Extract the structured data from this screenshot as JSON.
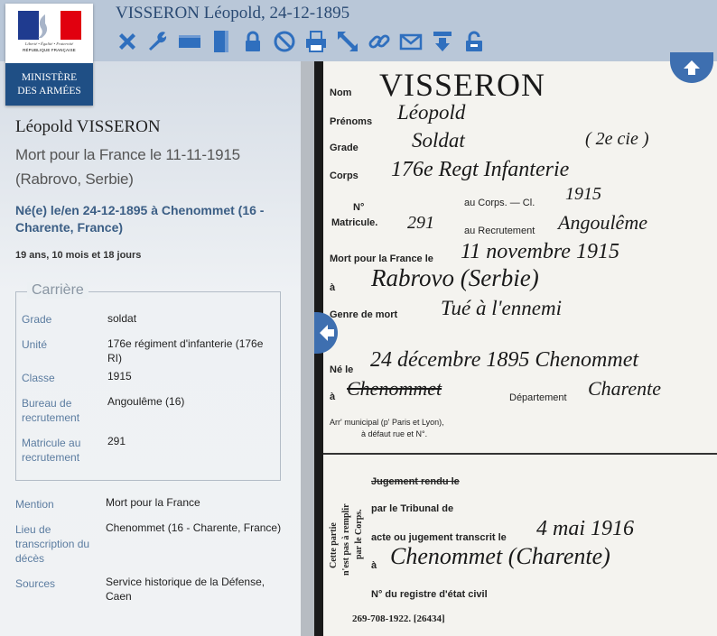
{
  "header": {
    "title": "VISSERON Léopold, 24-12-1895",
    "logo": {
      "motto": "Liberté • Égalité • Fraternité",
      "republic": "RÉPUBLIQUE FRANÇAISE",
      "ministry_line1": "MINISTÈRE",
      "ministry_line2": "DES ARMÉES"
    },
    "toolbar": [
      {
        "name": "close-icon"
      },
      {
        "name": "wrench-icon"
      },
      {
        "name": "horizontal-view-icon"
      },
      {
        "name": "vertical-view-icon"
      },
      {
        "name": "lock-icon"
      },
      {
        "name": "no-entry-icon"
      },
      {
        "name": "print-icon"
      },
      {
        "name": "expand-icon"
      },
      {
        "name": "link-icon"
      },
      {
        "name": "mail-icon"
      },
      {
        "name": "download-icon"
      },
      {
        "name": "unlock-icon"
      }
    ],
    "colors": {
      "toolbar_icon": "#2f6fbe",
      "ministry_blue": "#1f4f85",
      "topbar": "#b9c7d8"
    }
  },
  "person": {
    "name": "Léopold VISSERON",
    "death": "Mort pour la France le 11-11-1915 (Rabrovo, Serbie)",
    "birth": "Né(e) le/en 24-12-1895 à Chenommet (16 - Charente, France)",
    "age": "19 ans, 10 mois et 18 jours"
  },
  "career": {
    "legend": "Carrière",
    "fields": [
      {
        "label": "Grade",
        "value": "soldat"
      },
      {
        "label": "Unité",
        "value": "176e régiment d'infanterie (176e RI)"
      },
      {
        "label": "Classe",
        "value": "1915"
      },
      {
        "label": "Bureau de recrutement",
        "value": "Angoulême (16)"
      },
      {
        "label": "Matricule au recrutement",
        "value": "291"
      }
    ]
  },
  "other": [
    {
      "label": "Mention",
      "value": "Mort pour la France"
    },
    {
      "label": "Lieu de transcription du décès",
      "value": "Chenommet (16 - Charente, France)"
    },
    {
      "label": "Sources",
      "value": "Service historique de la Défense, Caen"
    }
  ],
  "scan": {
    "printed": {
      "nom": "Nom",
      "prenoms": "Prénoms",
      "grade": "Grade",
      "corps": "Corps",
      "no": "N°",
      "matricule": "Matricule.",
      "au_corps": "au Corps. — Cl.",
      "au_recrutement": "au Recrutement",
      "mort": "Mort pour la France le",
      "a1": "à",
      "genre": "Genre de mort",
      "ne": "Né le",
      "a2": "à",
      "departement": "Département",
      "arr1": "Arr' municipal (p' Paris et Lyon),",
      "arr2": "à défaut rue et N°.",
      "jugement_rendu": "Jugement rendu le",
      "par_tribunal": "par le Tribunal de",
      "acte": "acte ou jugement transcrit le",
      "a3": "à",
      "registre": "N° du registre d'état civil",
      "footer": "269-708-1922.  [26434]",
      "vert1": "Cette partie",
      "vert2": "n'est pas à remplir",
      "vert3": "par le Corps."
    },
    "handwritten": {
      "nom": "VISSERON",
      "prenoms": "Léopold",
      "grade": "Soldat",
      "grade_class": "( 2e cie )",
      "corps": "176e Regt Infanterie",
      "classe": "1915",
      "matricule": "291",
      "recrutement": "Angoulême",
      "mort": "11 novembre 1915",
      "lieu": "Rabrovo (Serbie)",
      "genre": "Tué à l'ennemi",
      "ne": "24 décembre 1895 Chenommet",
      "ne_lieu": "Chenommet",
      "departement": "Charente",
      "transcrit": "4 mai 1916",
      "transcrit_lieu": "Chenommet (Charente)"
    }
  }
}
